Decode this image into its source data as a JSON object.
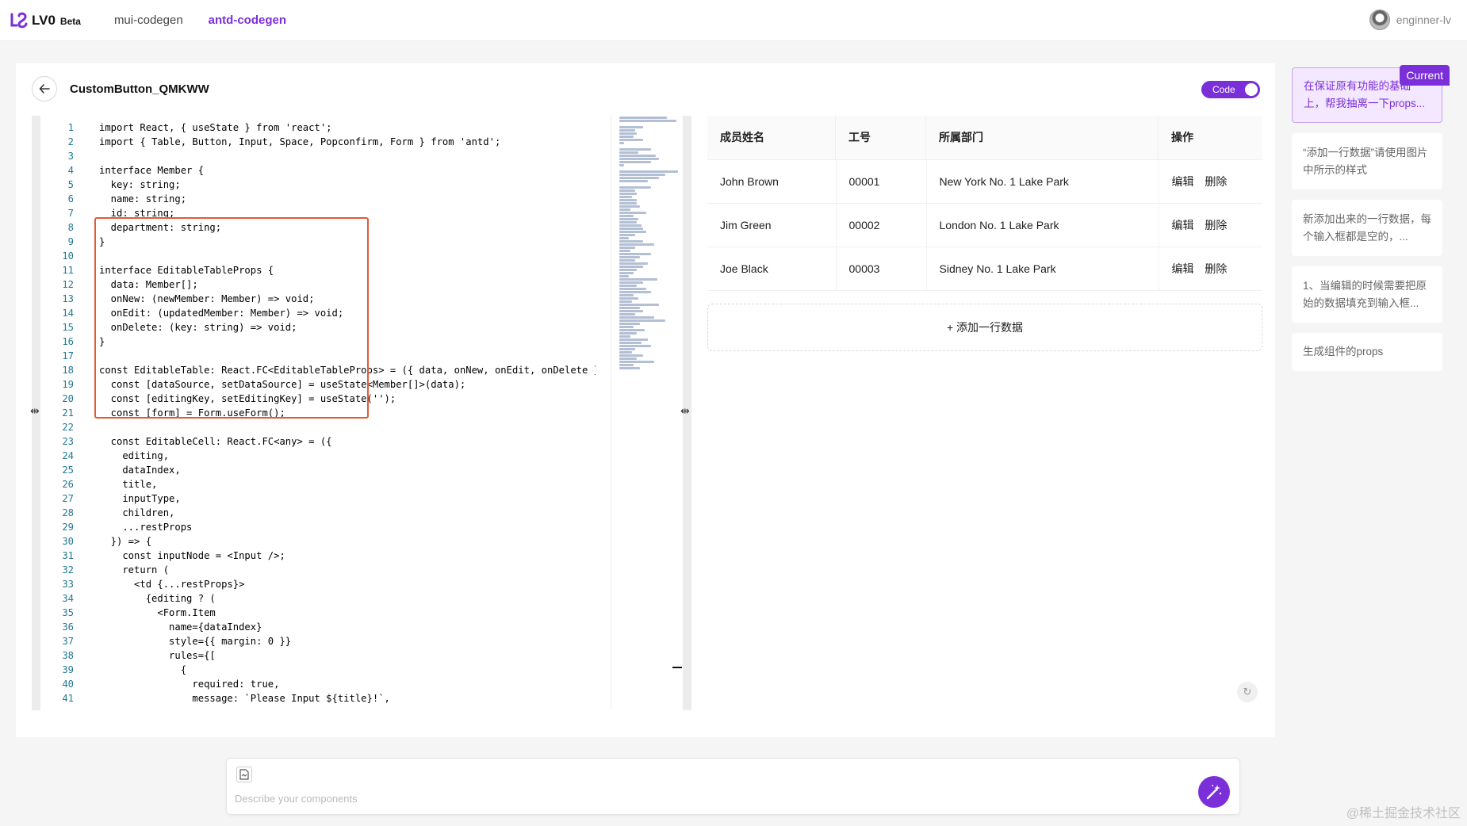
{
  "app": {
    "name": "LV0",
    "badge": "Beta",
    "nav": [
      {
        "label": "mui-codegen"
      },
      {
        "label": "antd-codegen"
      }
    ],
    "user": "enginner-lv"
  },
  "component": {
    "title": "CustomButton_QMKWW",
    "toggle_label": "Code"
  },
  "code": {
    "lines": [
      "import React, { useState } from 'react';",
      "import { Table, Button, Input, Space, Popconfirm, Form } from 'antd';",
      "",
      "interface Member {",
      "  key: string;",
      "  name: string;",
      "  id: string;",
      "  department: string;",
      "}",
      "",
      "interface EditableTableProps {",
      "  data: Member[];",
      "  onNew: (newMember: Member) => void;",
      "  onEdit: (updatedMember: Member) => void;",
      "  onDelete: (key: string) => void;",
      "}",
      "",
      "const EditableTable: React.FC<EditableTableProps> = ({ data, onNew, onEdit, onDelete })",
      "  const [dataSource, setDataSource] = useState<Member[]>(data);",
      "  const [editingKey, setEditingKey] = useState('');",
      "  const [form] = Form.useForm();",
      "",
      "  const EditableCell: React.FC<any> = ({",
      "    editing,",
      "    dataIndex,",
      "    title,",
      "    inputType,",
      "    children,",
      "    ...restProps",
      "  }) => {",
      "    const inputNode = <Input />;",
      "    return (",
      "      <td {...restProps}>",
      "        {editing ? (",
      "          <Form.Item",
      "            name={dataIndex}",
      "            style={{ margin: 0 }}",
      "            rules={[",
      "              {",
      "                required: true,",
      "                message: `Please Input ${title}!`,"
    ],
    "line_numbers": [
      "1",
      "2",
      "3",
      "4",
      "5",
      "6",
      "7",
      "8",
      "9",
      "10",
      "11",
      "12",
      "13",
      "14",
      "15",
      "16",
      "17",
      "18",
      "19",
      "20",
      "21",
      "22",
      "23",
      "24",
      "25",
      "26",
      "27",
      "28",
      "29",
      "30",
      "31",
      "32",
      "33",
      "34",
      "35",
      "36",
      "37",
      "38",
      "39",
      "40",
      "41"
    ]
  },
  "table": {
    "columns": [
      "成员姓名",
      "工号",
      "所属部门",
      "操作"
    ],
    "rows": [
      {
        "name": "John Brown",
        "id": "00001",
        "department": "New York No. 1 Lake Park",
        "edit": "编辑",
        "delete": "删除"
      },
      {
        "name": "Jim Green",
        "id": "00002",
        "department": "London No. 1 Lake Park",
        "edit": "编辑",
        "delete": "删除"
      },
      {
        "name": "Joe Black",
        "id": "00003",
        "department": "Sidney No. 1 Lake Park",
        "edit": "编辑",
        "delete": "删除"
      }
    ],
    "add_row_label": "+ 添加一行数据"
  },
  "history": {
    "current_badge": "Current",
    "items": [
      {
        "text": "在保证原有功能的基础上，帮我抽离一下props..."
      },
      {
        "text": "“添加一行数据”请使用图片中所示的样式"
      },
      {
        "text": "新添加出来的一行数据，每个输入框都是空的，..."
      },
      {
        "text": "1、当编辑的时候需要把原始的数据填充到输入框..."
      },
      {
        "text": "生成组件的props"
      }
    ]
  },
  "prompt": {
    "placeholder": "Describe your components"
  },
  "watermark": "@稀土掘金技术社区",
  "colors": {
    "accent": "#7b2fd8",
    "highlight_border": "#e05a3a"
  }
}
